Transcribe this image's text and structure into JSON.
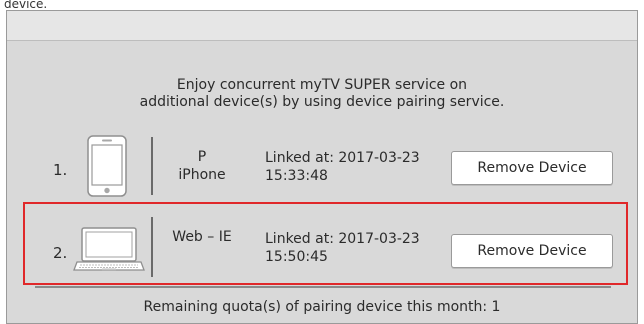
{
  "top_caption": "device.",
  "intro": {
    "line1": "Enjoy concurrent myTV SUPER service on",
    "line2": "additional device(s) by using device pairing service."
  },
  "devices": [
    {
      "number": "1.",
      "icon": "smartphone-icon",
      "name_line1": "P",
      "name_line2": "iPhone",
      "linked_line1": "Linked at: 2017-03-23",
      "linked_line2": "15:33:48",
      "button_label": "Remove Device"
    },
    {
      "number": "2.",
      "icon": "laptop-icon",
      "name_line1": "Web – IE",
      "name_line2": "",
      "linked_line1": "Linked at: 2017-03-23",
      "linked_line2": "15:50:45",
      "button_label": "Remove Device"
    }
  ],
  "quota_text": "Remaining quota(s) of pairing device this month: 1",
  "colors": {
    "panel_bg": "#d9d9d9",
    "highlight": "#e0282a",
    "button_bg": "#ffffff"
  }
}
